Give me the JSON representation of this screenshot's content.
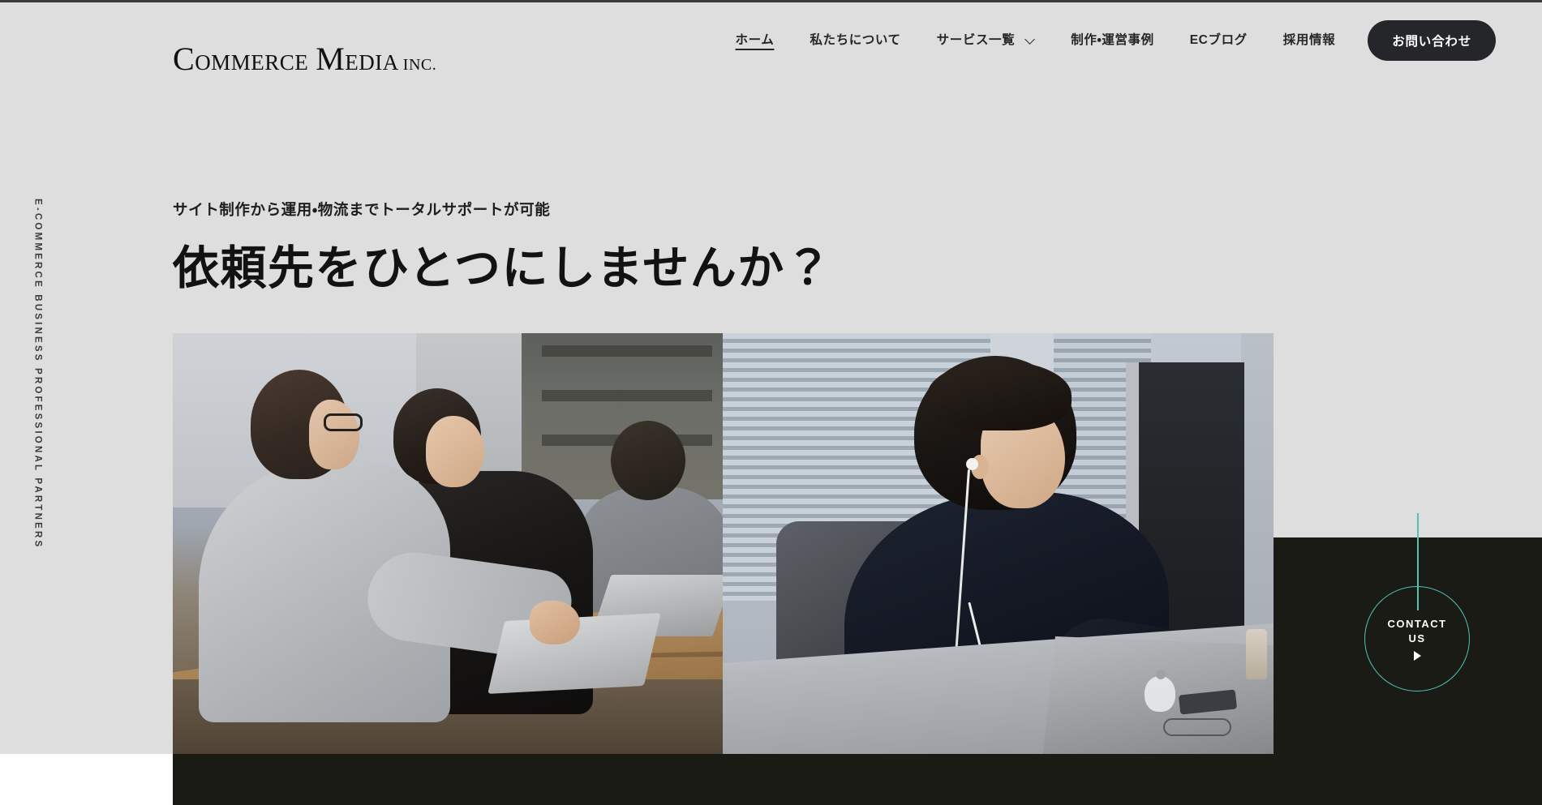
{
  "site": {
    "logo": {
      "line": "COMMERCE MEDIA INC.",
      "part_commerce_cap": "C",
      "part_commerce_rest": "OMMERCE",
      "part_media_cap": "M",
      "part_media_rest": "EDIA",
      "part_inc": "INC."
    }
  },
  "nav": {
    "items": [
      {
        "label": "ホーム",
        "active": true,
        "has_dropdown": false
      },
      {
        "label": "私たちについて",
        "active": false,
        "has_dropdown": false
      },
      {
        "label": "サービス一覧",
        "active": false,
        "has_dropdown": true
      },
      {
        "label": "制作・運営事例",
        "active": false,
        "has_dropdown": false
      },
      {
        "label": "ECブログ",
        "active": false,
        "has_dropdown": false
      },
      {
        "label": "採用情報",
        "active": false,
        "has_dropdown": false
      }
    ],
    "cta_label": "お問い合わせ"
  },
  "side_label": {
    "text": "E-COMMERCE BUSINESS   PROFESSIONAL PARTNERS"
  },
  "hero": {
    "subtitle": "サイト制作から運用・物流までトータルサポートが可能",
    "title": "依頼先をひとつにしませんか？",
    "photos": [
      {
        "alt": "オフィスで笑顔でノートパソコンを操作する男性2人と背後のスタッフ"
      },
      {
        "alt": "イヤホンをしてデスクでノートパソコンに向かう男性"
      }
    ]
  },
  "contact_widget": {
    "line1": "CONTACT",
    "line2": "US",
    "play_icon": "play-triangle-icon"
  },
  "colors": {
    "page_background": "#dedede",
    "dark_section": "#1b1b16",
    "accent_teal": "#4ec3bb",
    "cta_dark": "#25262a",
    "text_primary": "#121212",
    "white": "#ffffff"
  }
}
